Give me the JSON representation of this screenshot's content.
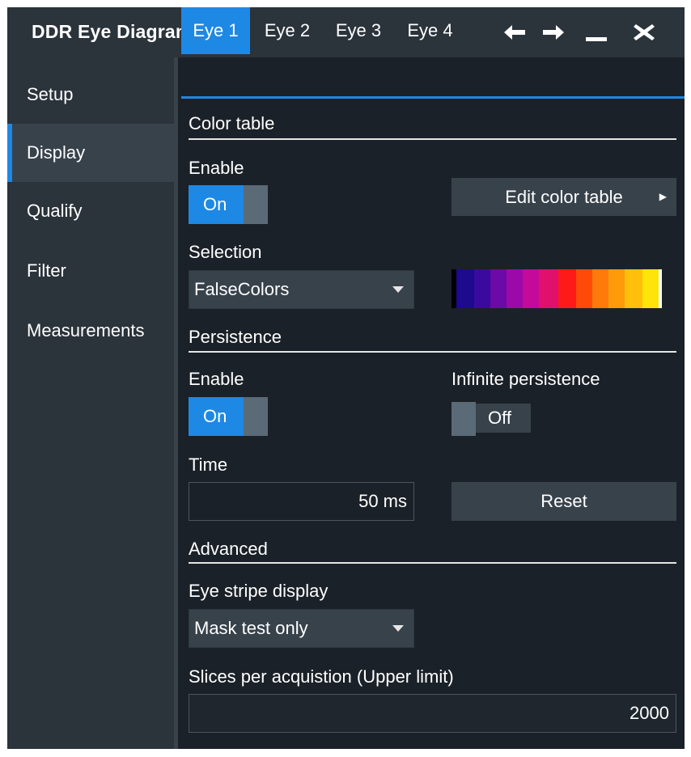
{
  "window": {
    "title": "DDR Eye Diagram",
    "controls": [
      "back-arrow-icon",
      "forward-arrow-icon",
      "minimize-icon",
      "close-icon"
    ]
  },
  "sidebar": {
    "items": [
      {
        "label": "Setup",
        "active": false
      },
      {
        "label": "Display",
        "active": true
      },
      {
        "label": "Qualify",
        "active": false
      },
      {
        "label": "Filter",
        "active": false
      },
      {
        "label": "Measurements",
        "active": false
      }
    ]
  },
  "tabs": [
    {
      "label": "Eye 1",
      "active": true
    },
    {
      "label": "Eye 2",
      "active": false
    },
    {
      "label": "Eye 3",
      "active": false
    },
    {
      "label": "Eye 4",
      "active": false
    }
  ],
  "color_table": {
    "section_title": "Color table",
    "enable_label": "Enable",
    "enable_state": "On",
    "edit_button": "Edit color table",
    "selection_label": "Selection",
    "selection_value": "FalseColors",
    "palette_colors": [
      "#000000",
      "#1d0a8c",
      "#3a0a9e",
      "#6b0aa6",
      "#9b0aa8",
      "#c40a9a",
      "#e0106c",
      "#ff1a1a",
      "#ff4a0a",
      "#ff7a0a",
      "#ff9a0a",
      "#ffbf0a",
      "#ffe40a",
      "#ffffff"
    ]
  },
  "persistence": {
    "section_title": "Persistence",
    "enable_label": "Enable",
    "enable_state": "On",
    "infinite_label": "Infinite persistence",
    "infinite_state": "Off",
    "time_label": "Time",
    "time_value": "50 ms",
    "reset_button": "Reset"
  },
  "advanced": {
    "section_title": "Advanced",
    "eye_stripe_label": "Eye stripe display",
    "eye_stripe_value": "Mask test only",
    "slices_label": "Slices per acquistion (Upper limit)",
    "slices_value": "2000"
  },
  "colors": {
    "accent": "#1e88e5",
    "panel": "#1b2128",
    "sidebar": "#2b333b",
    "control": "#38424b"
  }
}
